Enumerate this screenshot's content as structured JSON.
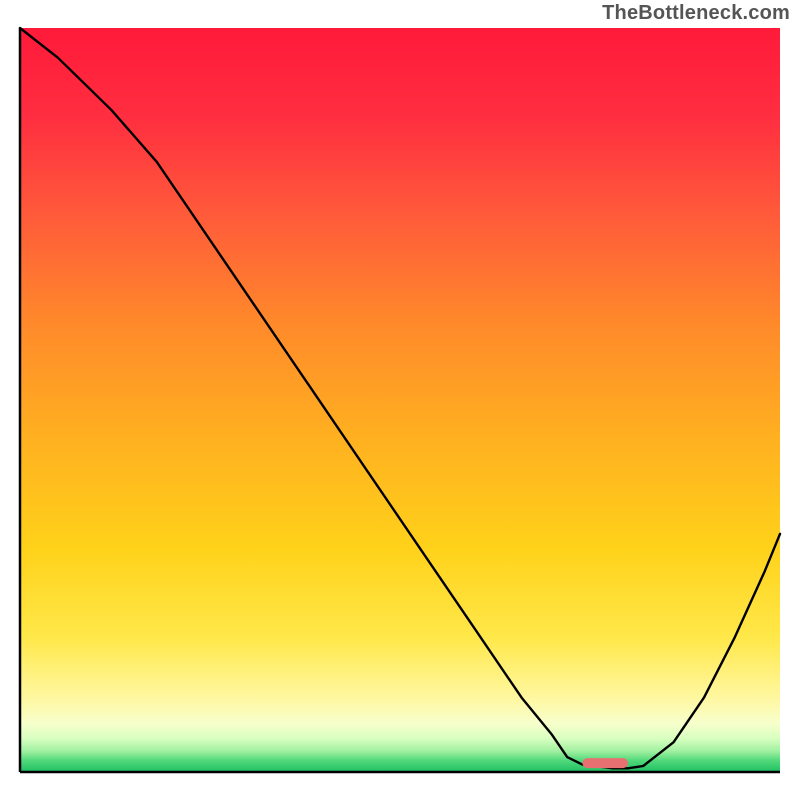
{
  "watermark": "TheBottleneck.com",
  "chart_data": {
    "type": "line",
    "title": "",
    "xlabel": "",
    "ylabel": "",
    "xlim": [
      0,
      100
    ],
    "ylim": [
      0,
      100
    ],
    "grid": false,
    "legend": false,
    "gradient_stops": [
      {
        "offset": 0.0,
        "color": "#ff1a3a"
      },
      {
        "offset": 0.12,
        "color": "#ff2e40"
      },
      {
        "offset": 0.25,
        "color": "#ff5a3a"
      },
      {
        "offset": 0.4,
        "color": "#ff8a2a"
      },
      {
        "offset": 0.55,
        "color": "#ffb020"
      },
      {
        "offset": 0.7,
        "color": "#ffd21a"
      },
      {
        "offset": 0.82,
        "color": "#ffe84a"
      },
      {
        "offset": 0.9,
        "color": "#fff7a0"
      },
      {
        "offset": 0.935,
        "color": "#f7ffcc"
      },
      {
        "offset": 0.955,
        "color": "#d8ffc0"
      },
      {
        "offset": 0.972,
        "color": "#a0f0a0"
      },
      {
        "offset": 0.985,
        "color": "#4fd87a"
      },
      {
        "offset": 1.0,
        "color": "#1fbf63"
      }
    ],
    "series": [
      {
        "name": "bottleneck-curve",
        "x": [
          0,
          5,
          12,
          18,
          22,
          30,
          38,
          46,
          54,
          60,
          66,
          70,
          72,
          74,
          78,
          80,
          82,
          86,
          90,
          94,
          98,
          100
        ],
        "y": [
          100,
          96,
          89,
          82,
          76,
          64,
          52,
          40,
          28,
          19,
          10,
          5,
          2,
          1,
          0.5,
          0.5,
          0.8,
          4,
          10,
          18,
          27,
          32
        ]
      }
    ],
    "marker": {
      "name": "optimal-range",
      "x_start": 74,
      "x_end": 80,
      "y": 1.2,
      "color": "#e87070"
    },
    "axes": {
      "color": "#000000",
      "baseline_y": 0
    }
  }
}
